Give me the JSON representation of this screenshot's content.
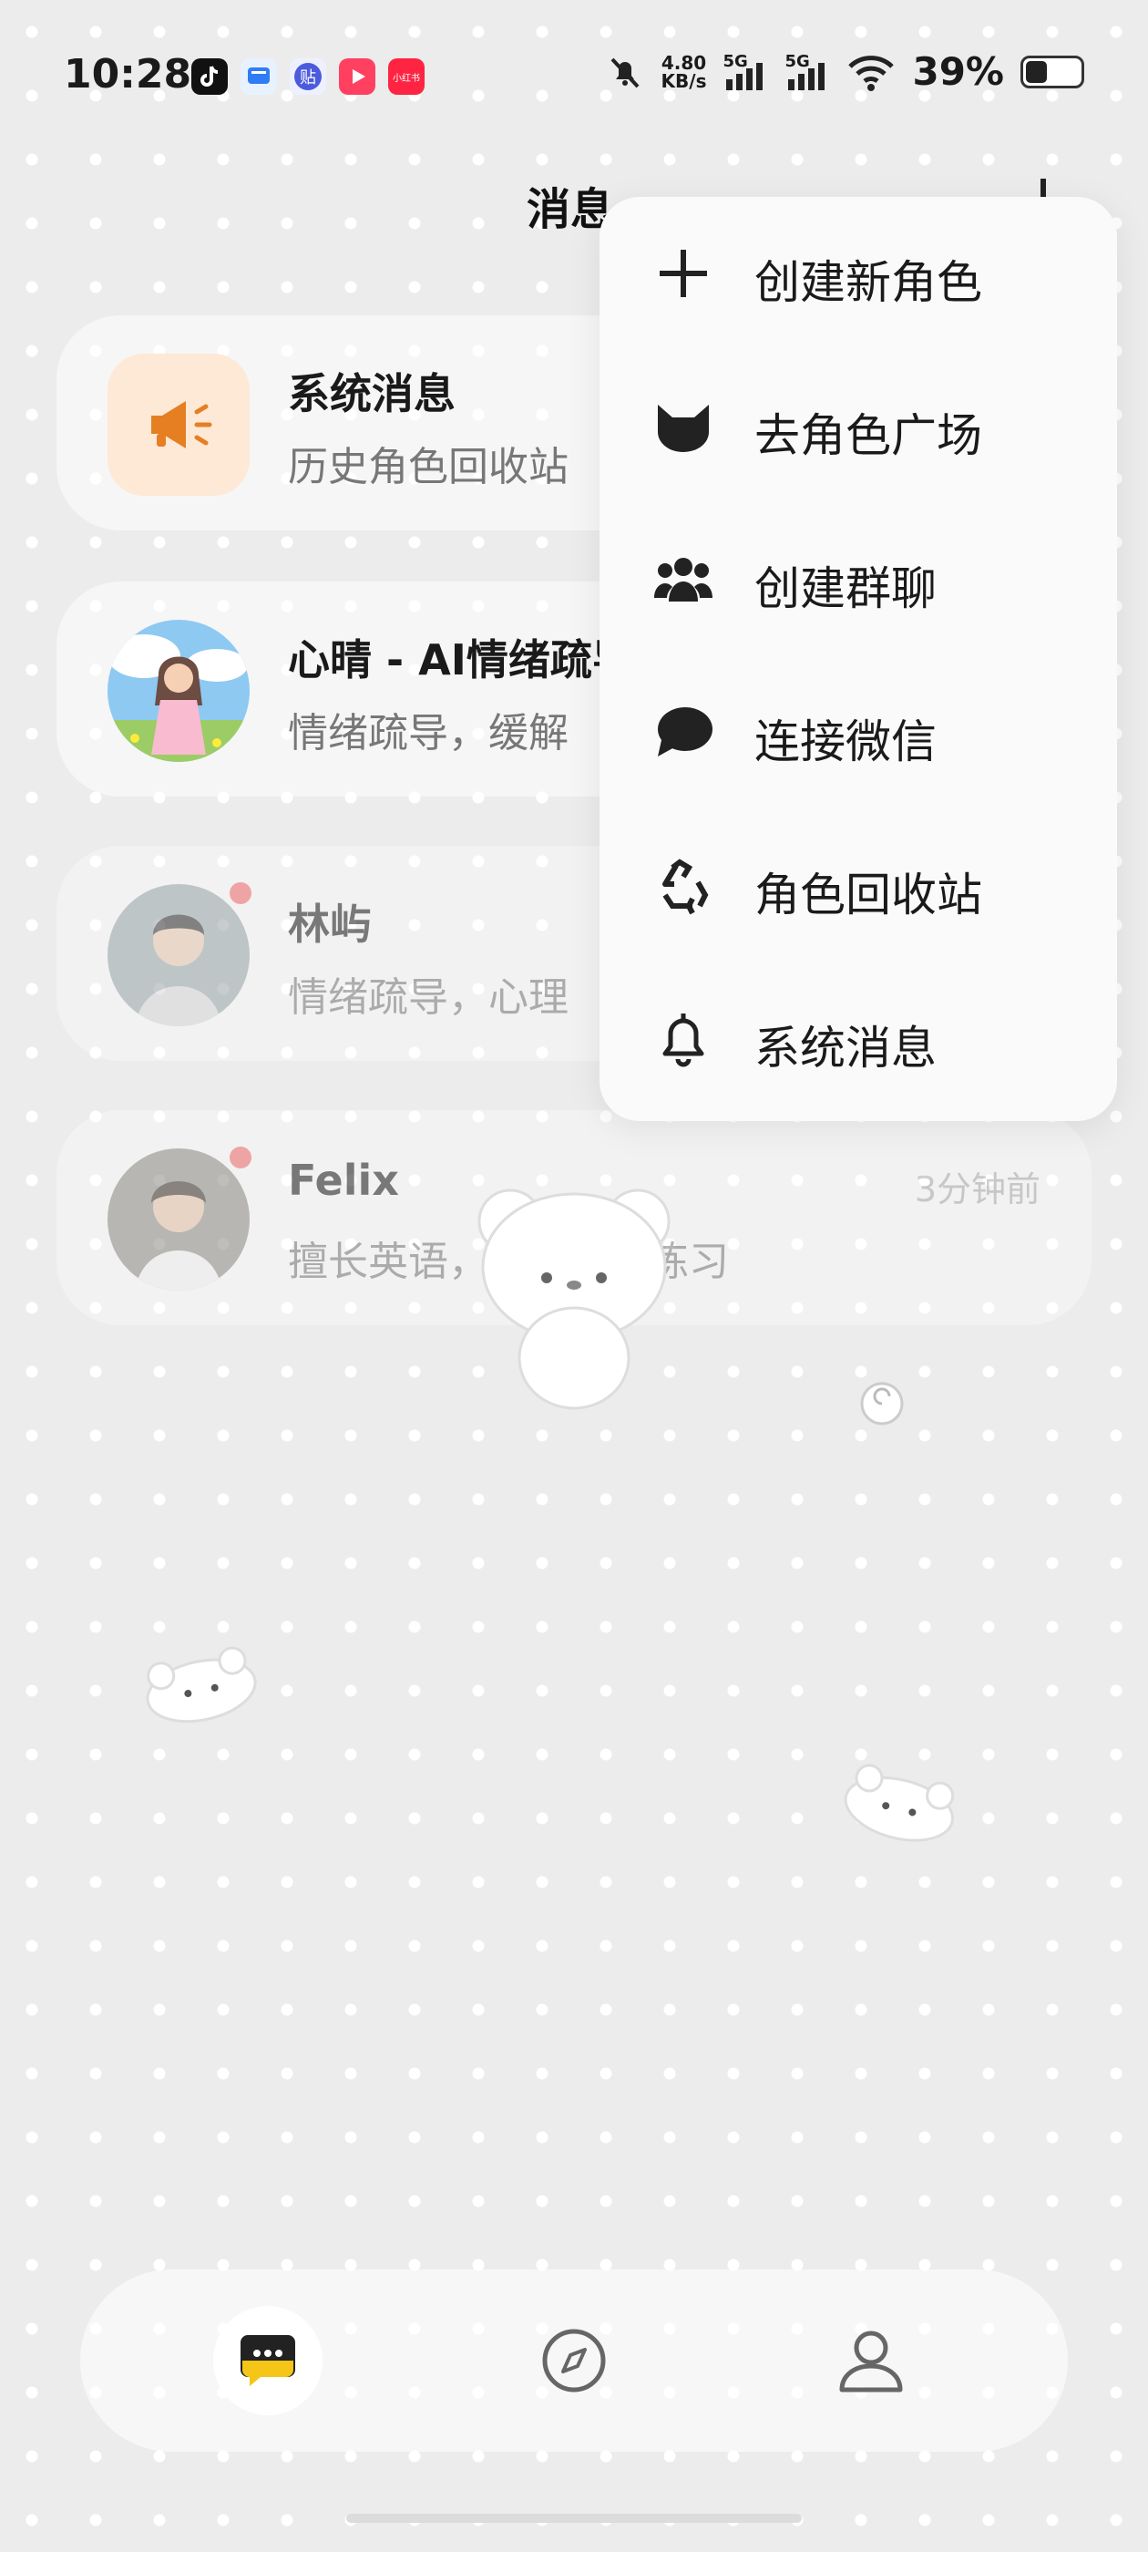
{
  "status_bar": {
    "time": "10:28",
    "net_speed_value": "4.80",
    "net_speed_unit": "KB/s",
    "sim1": "5G",
    "sim2": "5G",
    "battery_percent": "39%",
    "battery_level": 0.39,
    "app_icons": [
      "tiktok-icon",
      "app-blue-icon",
      "tieba-icon",
      "video-red-icon",
      "xiaohongshu-icon"
    ],
    "app_icon_texts": {
      "tieba": "贴",
      "xiaohongshu": "小红书"
    }
  },
  "header": {
    "title": "消息"
  },
  "conversations": [
    {
      "title": "系统消息",
      "subtitle": "历史角色回收站",
      "time": "",
      "unread": false
    },
    {
      "title": "心晴 - AI情绪疏导",
      "subtitle": "情绪疏导，缓解",
      "time": "",
      "unread": false
    },
    {
      "title": "林屿",
      "subtitle": "情绪疏导，心理",
      "time": "",
      "unread": true
    },
    {
      "title": "Felix",
      "subtitle": "擅长英语，英语听力练习",
      "time": "3分钟前",
      "unread": true
    }
  ],
  "menu": {
    "items": [
      {
        "label": "创建新角色",
        "icon": "plus-icon"
      },
      {
        "label": "去角色广场",
        "icon": "cat-face-icon"
      },
      {
        "label": "创建群聊",
        "icon": "group-users-icon"
      },
      {
        "label": "连接微信",
        "icon": "chat-bubble-icon"
      },
      {
        "label": "角色回收站",
        "icon": "recycle-icon"
      },
      {
        "label": "系统消息",
        "icon": "bell-icon"
      }
    ]
  },
  "tab_bar": {
    "tabs": [
      {
        "name": "messages",
        "icon": "chat-icon",
        "active": true
      },
      {
        "name": "discover",
        "icon": "compass-icon",
        "active": false
      },
      {
        "name": "profile",
        "icon": "user-icon",
        "active": false
      }
    ]
  },
  "colors": {
    "background": "#ececec",
    "unread_dot": "#f06a6a",
    "system_icon_bg": "#fde9d6",
    "system_icon": "#e67e22",
    "active_tab_accent": "#f5c518"
  }
}
